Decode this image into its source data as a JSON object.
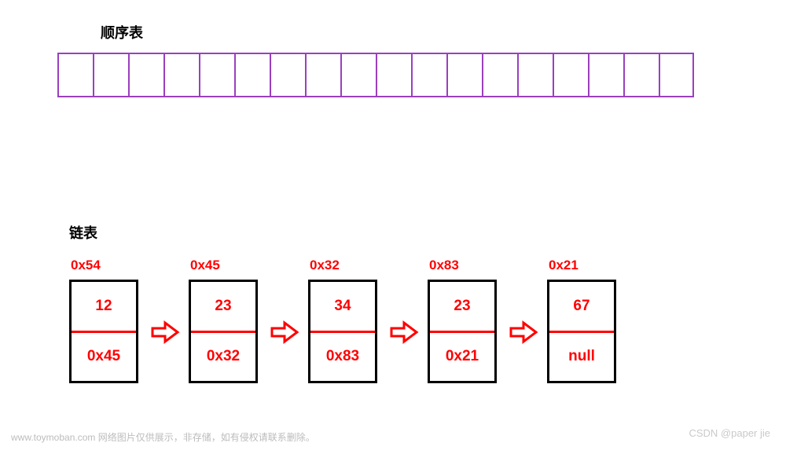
{
  "titles": {
    "array": "顺序表",
    "linked": "链表"
  },
  "array": {
    "cell_count": 18
  },
  "linked": {
    "nodes": [
      {
        "addr": "0x54",
        "value": "12",
        "next": "0x45"
      },
      {
        "addr": "0x45",
        "value": "23",
        "next": "0x32"
      },
      {
        "addr": "0x32",
        "value": "34",
        "next": "0x83"
      },
      {
        "addr": "0x83",
        "value": "23",
        "next": "0x21"
      },
      {
        "addr": "0x21",
        "value": "67",
        "next": "null"
      }
    ]
  },
  "watermark": {
    "left": "www.toymoban.com  网络图片仅供展示，非存储，如有侵权请联系删除。",
    "right": "CSDN @paper jie"
  },
  "colors": {
    "array_border": "#9b3fbf",
    "node_border": "#000000",
    "accent": "#ff0000"
  }
}
